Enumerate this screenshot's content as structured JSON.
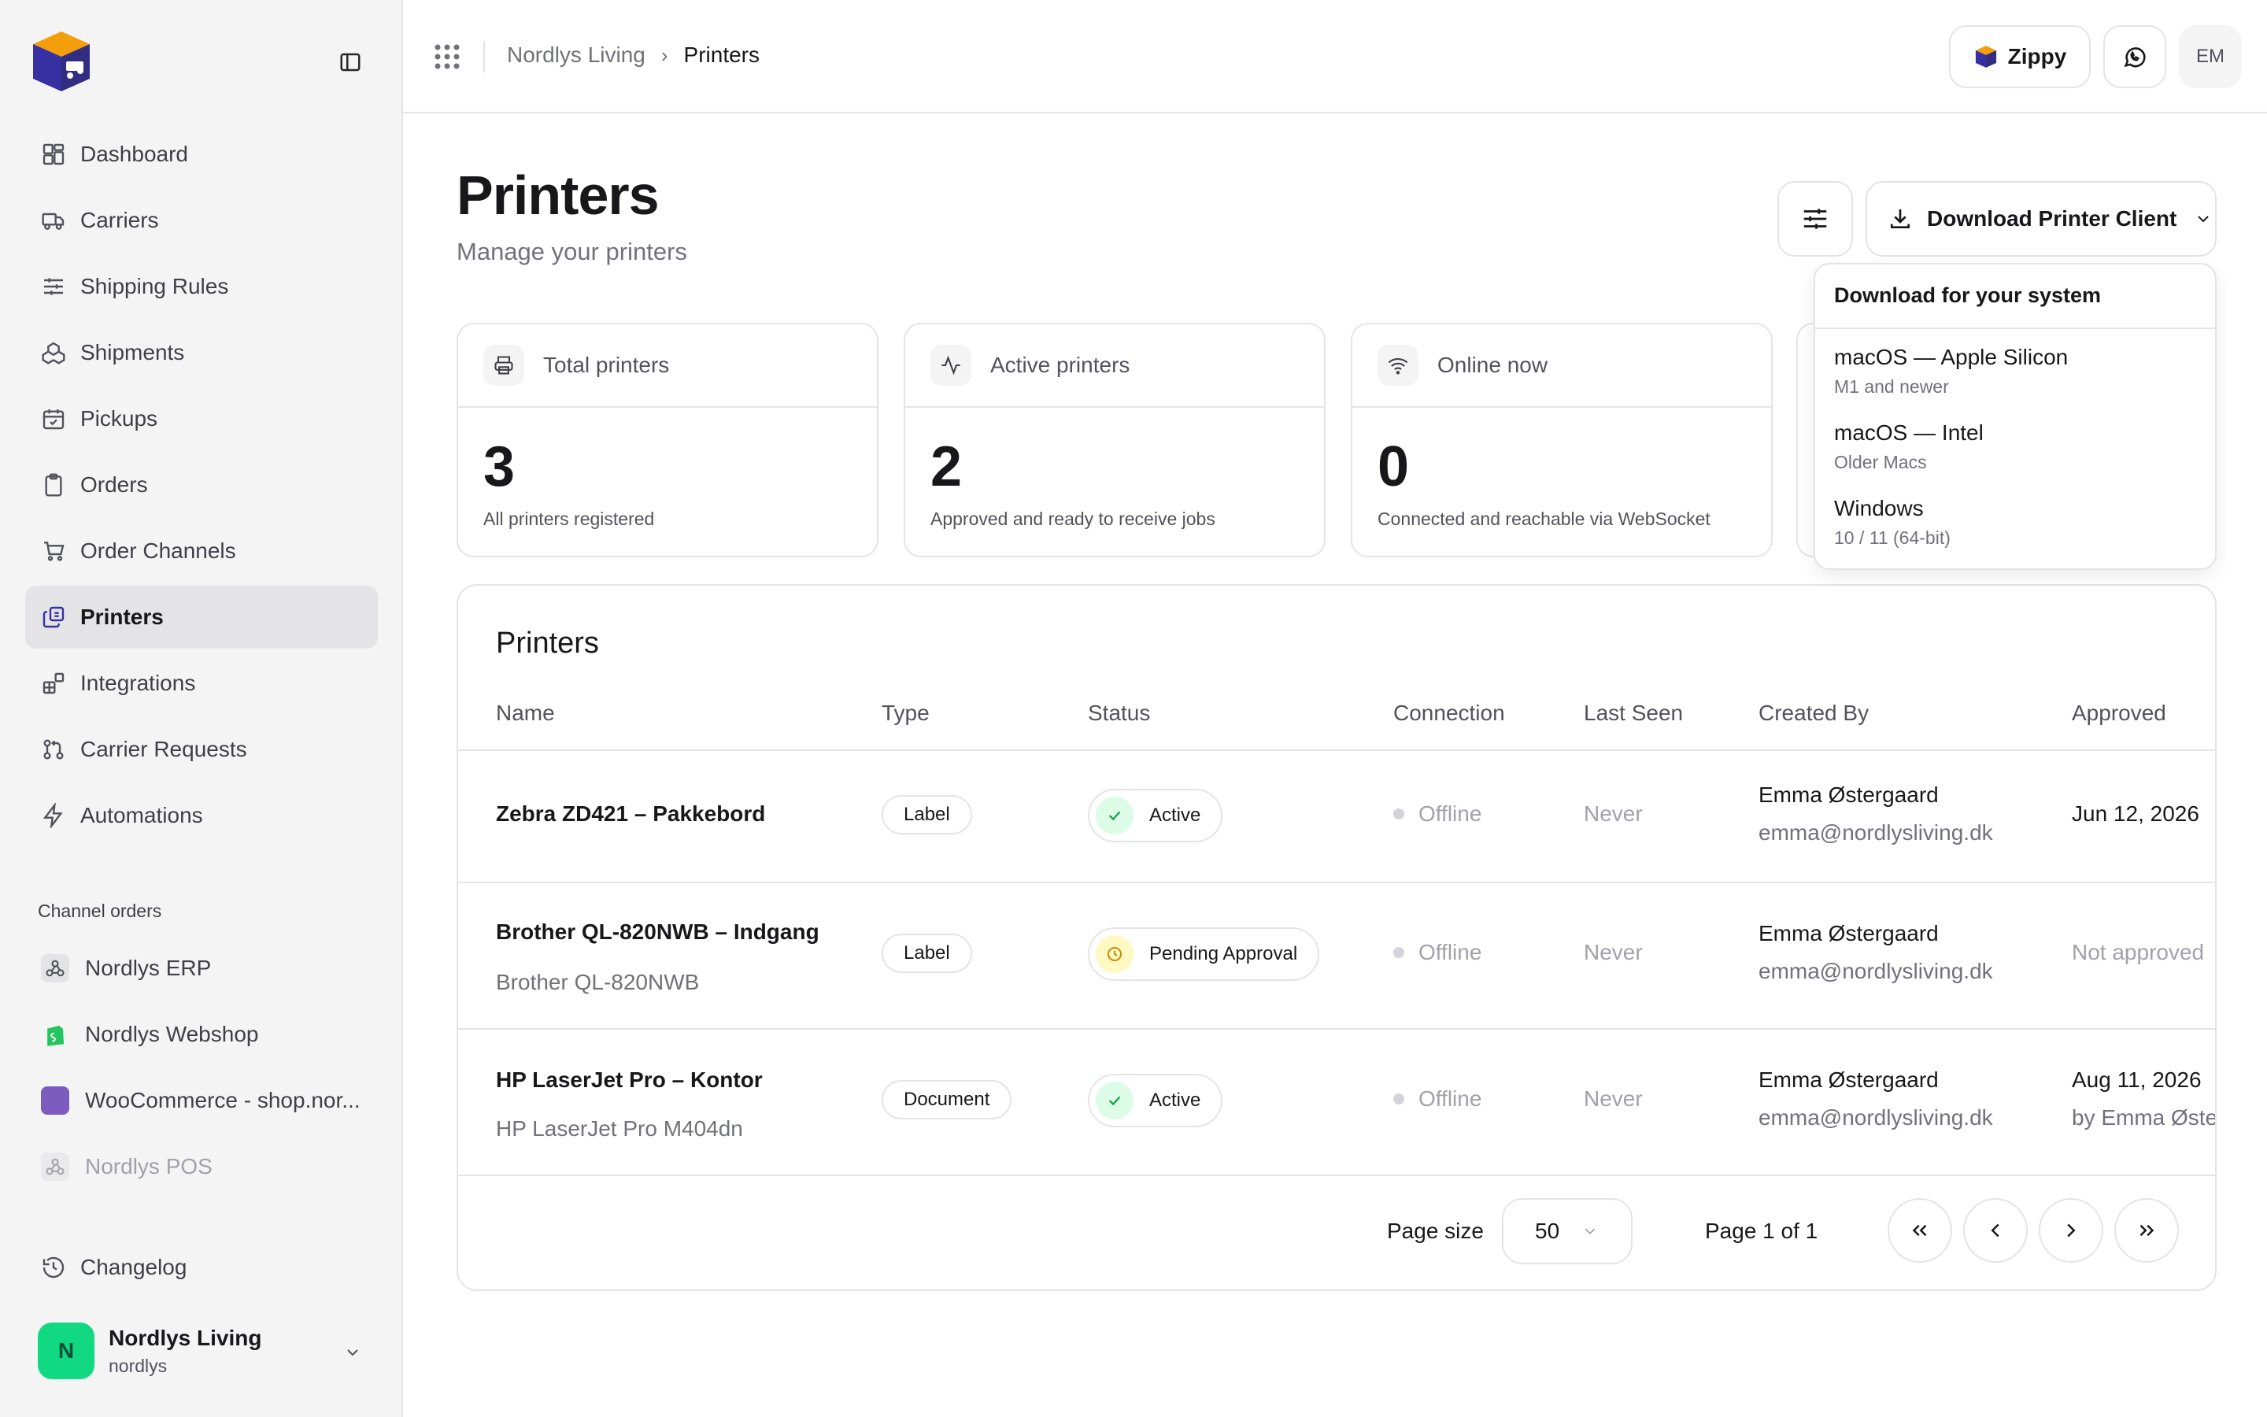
{
  "sidebar": {
    "nav": [
      {
        "label": "Dashboard",
        "icon": "dashboard-icon"
      },
      {
        "label": "Carriers",
        "icon": "truck-icon"
      },
      {
        "label": "Shipping Rules",
        "icon": "sliders-icon"
      },
      {
        "label": "Shipments",
        "icon": "boxes-icon"
      },
      {
        "label": "Pickups",
        "icon": "calendar-check-icon"
      },
      {
        "label": "Orders",
        "icon": "clipboard-icon"
      },
      {
        "label": "Order Channels",
        "icon": "cart-icon"
      },
      {
        "label": "Printers",
        "icon": "printers-icon",
        "active": true
      },
      {
        "label": "Integrations",
        "icon": "blocks-icon"
      },
      {
        "label": "Carrier Requests",
        "icon": "git-pull-request-icon"
      },
      {
        "label": "Automations",
        "icon": "zap-icon"
      }
    ],
    "section_label": "Channel orders",
    "channels": [
      {
        "label": "Nordlys ERP",
        "icon": "webhook-icon"
      },
      {
        "label": "Nordlys Webshop",
        "icon": "shopify-icon"
      },
      {
        "label": "WooCommerce - shop.nor...",
        "icon": "woocommerce-icon"
      },
      {
        "label": "Nordlys POS",
        "icon": "webhook-icon"
      }
    ],
    "changelog": "Changelog",
    "account": {
      "initial": "N",
      "name": "Nordlys Living",
      "handle": "nordlys"
    }
  },
  "topbar": {
    "breadcrumb": [
      "Nordlys Living",
      "Printers"
    ],
    "breadcrumb_sep": "›",
    "zippy_label": "Zippy",
    "user_initials": "EM"
  },
  "page": {
    "title": "Printers",
    "subtitle": "Manage your printers",
    "download_label": "Download Printer Client"
  },
  "stats": [
    {
      "label": "Total printers",
      "value": "3",
      "desc": "All printers registered",
      "icon": "printer-icon"
    },
    {
      "label": "Active printers",
      "value": "2",
      "desc": "Approved and ready to receive jobs",
      "icon": "activity-icon"
    },
    {
      "label": "Online now",
      "value": "0",
      "desc": "Connected and reachable via WebSocket",
      "icon": "wifi-icon"
    }
  ],
  "table": {
    "title": "Printers",
    "columns": [
      "Name",
      "Type",
      "Status",
      "Connection",
      "Last Seen",
      "Created By",
      "Approved"
    ],
    "rows": [
      {
        "name": "Zebra ZD421 – Pakkebord",
        "model": "",
        "type": "Label",
        "status": "Active",
        "status_kind": "active",
        "connection": "Offline",
        "last_seen": "Never",
        "created_by": "Emma Østergaard",
        "email": "emma@nordlysliving.dk",
        "approved": "Jun 12, 2026",
        "approved_by": ""
      },
      {
        "name": "Brother QL-820NWB – Indgang",
        "model": "Brother QL-820NWB",
        "type": "Label",
        "status": "Pending Approval",
        "status_kind": "pending",
        "connection": "Offline",
        "last_seen": "Never",
        "created_by": "Emma Østergaard",
        "email": "emma@nordlysliving.dk",
        "approved": "Not approved",
        "approved_by": ""
      },
      {
        "name": "HP LaserJet Pro – Kontor",
        "model": "HP LaserJet Pro M404dn",
        "type": "Document",
        "status": "Active",
        "status_kind": "active",
        "connection": "Offline",
        "last_seen": "Never",
        "created_by": "Emma Østergaard",
        "email": "emma@nordlysliving.dk",
        "approved": "Aug 11, 2026",
        "approved_by": "by Emma Øste"
      }
    ],
    "pager": {
      "page_size_label": "Page size",
      "page_size": "50",
      "page_info": "Page 1 of 1"
    }
  },
  "dropdown": {
    "header": "Download for your system",
    "items": [
      {
        "title": "macOS — Apple Silicon",
        "sub": "M1 and newer"
      },
      {
        "title": "macOS — Intel",
        "sub": "Older Macs"
      },
      {
        "title": "Windows",
        "sub": "10 / 11 (64-bit)"
      }
    ]
  },
  "colors": {
    "accent": "#3730a3",
    "brand_orange": "#f59e0b",
    "success": "#16a34a",
    "warning": "#ca8a04",
    "avatar_green": "#10d982"
  }
}
